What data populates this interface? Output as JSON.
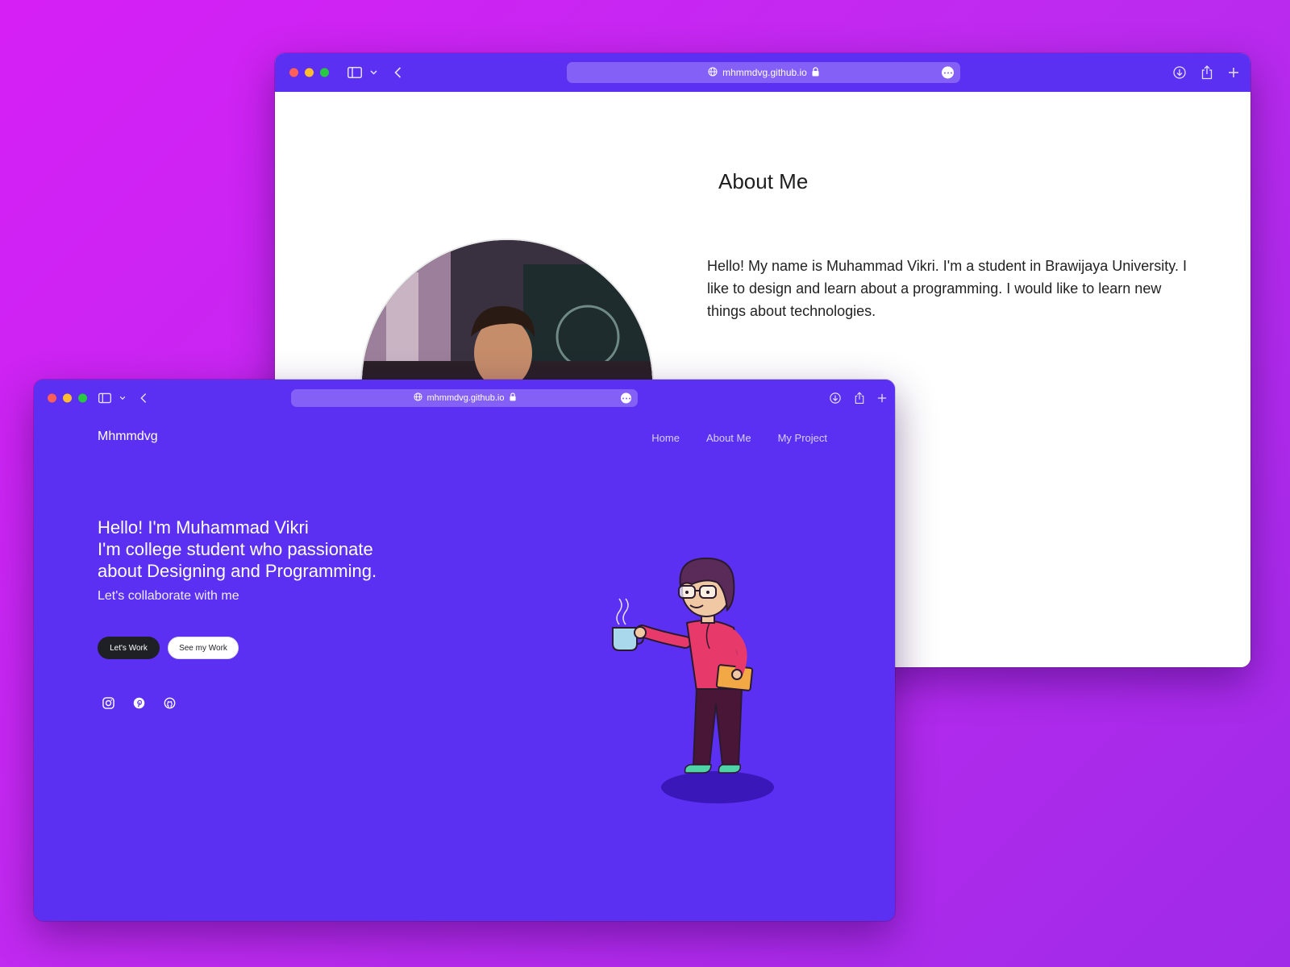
{
  "back_window": {
    "url": "mhmmdvg.github.io",
    "about_title": "About Me",
    "about_text": "Hello! My name is Muhammad Vikri. I'm a student in Brawijaya University. I like to design and learn about a programming. I would like to learn new things about technologies."
  },
  "front_window": {
    "url": "mhmmdvg.github.io",
    "brand": "Mhmmdvg",
    "nav": [
      "Home",
      "About Me",
      "My Project"
    ],
    "hero_lines": [
      "Hello! I'm Muhammad Vikri",
      "I'm college student who passionate",
      "about Designing and Programming."
    ],
    "hero_sub": "Let's collaborate with me",
    "buttons": {
      "primary": "Let's Work",
      "secondary": "See my Work"
    },
    "socials": [
      "instagram-icon",
      "pinterest-icon",
      "github-icon"
    ]
  },
  "colors": {
    "background_gradient_start": "#d61ff5",
    "background_gradient_end": "#a02ae8",
    "brand_purple": "#5b30f2",
    "url_bar": "#8560f7",
    "dark_button": "#1f1f26"
  }
}
